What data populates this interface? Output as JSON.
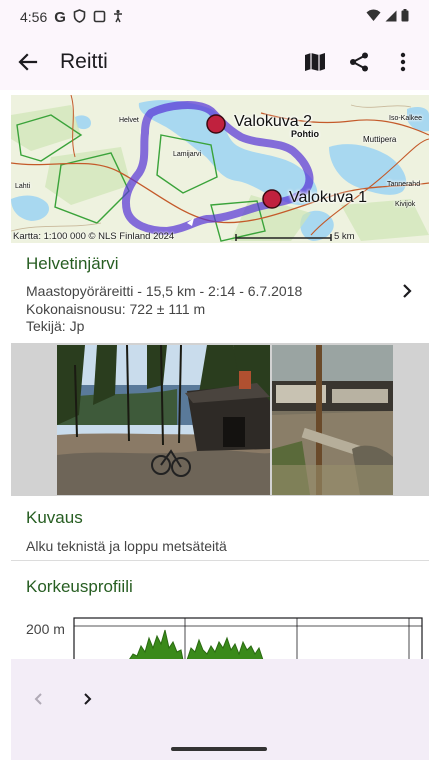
{
  "status_bar": {
    "time": "4:56",
    "icons": [
      "google-icon",
      "shield-icon",
      "screen-icon",
      "accessibility-icon"
    ],
    "right_icons": [
      "wifi-icon",
      "signal-icon",
      "battery-icon"
    ]
  },
  "app_bar": {
    "title": "Reitti",
    "actions": [
      "map-icon",
      "share-icon",
      "more-vert-icon"
    ]
  },
  "map": {
    "markers": [
      "Valokuva 2",
      "Valokuva 1"
    ],
    "credit": "Kartta: 1:100 000 © NLS Finland 2024",
    "scale": "5 km",
    "place_names": [
      "Pohtio",
      "Muttipera",
      "Iso-Kalkee",
      "Tannerahd",
      "Kivijok",
      "Helvet",
      "Lamijarvi",
      "Lahti"
    ],
    "route_color": "#5533d6",
    "marker_color": "#c0213e"
  },
  "route": {
    "name": "Helvetinjärvi",
    "summary": "Maastopyöräreitti - 15,5 km - 2:14 - 6.7.2018",
    "ascent": "Kokonaisnousu: 722 ± 111 m",
    "author": "Tekijä: Jp"
  },
  "photos": [
    "Hut by the lake",
    "Hut interior"
  ],
  "description": {
    "title": "Kuvaus",
    "text": "Alku teknistä ja loppu metsäteitä"
  },
  "elevation": {
    "title": "Korkeusprofiili",
    "ytick_label": "200 m"
  },
  "bottom_nav": {
    "prev_icon": "chevron-left-icon",
    "next_icon": "chevron-right-icon"
  },
  "colors": {
    "accent_green": "#275e22",
    "surface": "#fcf6fc",
    "bottom_surface": "#f3edf7"
  }
}
